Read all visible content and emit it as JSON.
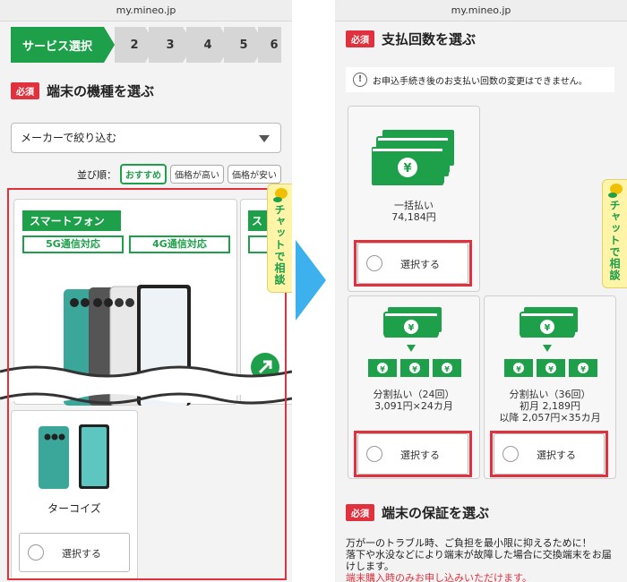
{
  "url": "my.mineo.jp",
  "steps": [
    "サービス選択",
    "2",
    "3",
    "4",
    "5",
    "6"
  ],
  "left": {
    "required_badge": "必須",
    "device_section_title": "端末の機種を選ぶ",
    "maker_filter_placeholder": "メーカーで絞り込む",
    "sort_label": "並び順：",
    "sort_options": [
      "おすすめ",
      "価格が高い",
      "価格が安い"
    ],
    "category_tag": "スマートフォン",
    "category_tag_short": "ス",
    "network_tags": [
      "5G通信対応",
      "4G通信対応"
    ],
    "network_tag_short": "",
    "color_name": "ターコイズ",
    "select_button": "選択する"
  },
  "chat_tab_label": "チャットで相談",
  "right": {
    "required_badge": "必須",
    "payment_section_title": "支払回数を選ぶ",
    "notice_text": "お申込手続き後のお支払い回数の変更はできません。",
    "payment_options": [
      {
        "title": "一括払い",
        "price": "74,184円",
        "detail": ""
      },
      {
        "title": "分割払い（24回）",
        "price": "3,091円×24カ月",
        "detail": ""
      },
      {
        "title": "分割払い（36回）",
        "price": "初月 2,189円",
        "detail": "以降 2,057円×35カ月"
      }
    ],
    "select_button": "選択する",
    "warranty_badge": "必須",
    "warranty_title": "端末の保証を選ぶ",
    "warranty_line1": "万が一のトラブル時、ご負担を最小限に抑えるために！",
    "warranty_line2": "落下や水没などにより端末が故障した場合に交換端末をお届けします。",
    "warranty_note": "端末購入時のみお申し込みいただけます。"
  },
  "colors": {
    "green": "#1e9f4a",
    "red": "#e0323e",
    "arrow": "#3db1ee",
    "teal": "#3aa79a"
  }
}
